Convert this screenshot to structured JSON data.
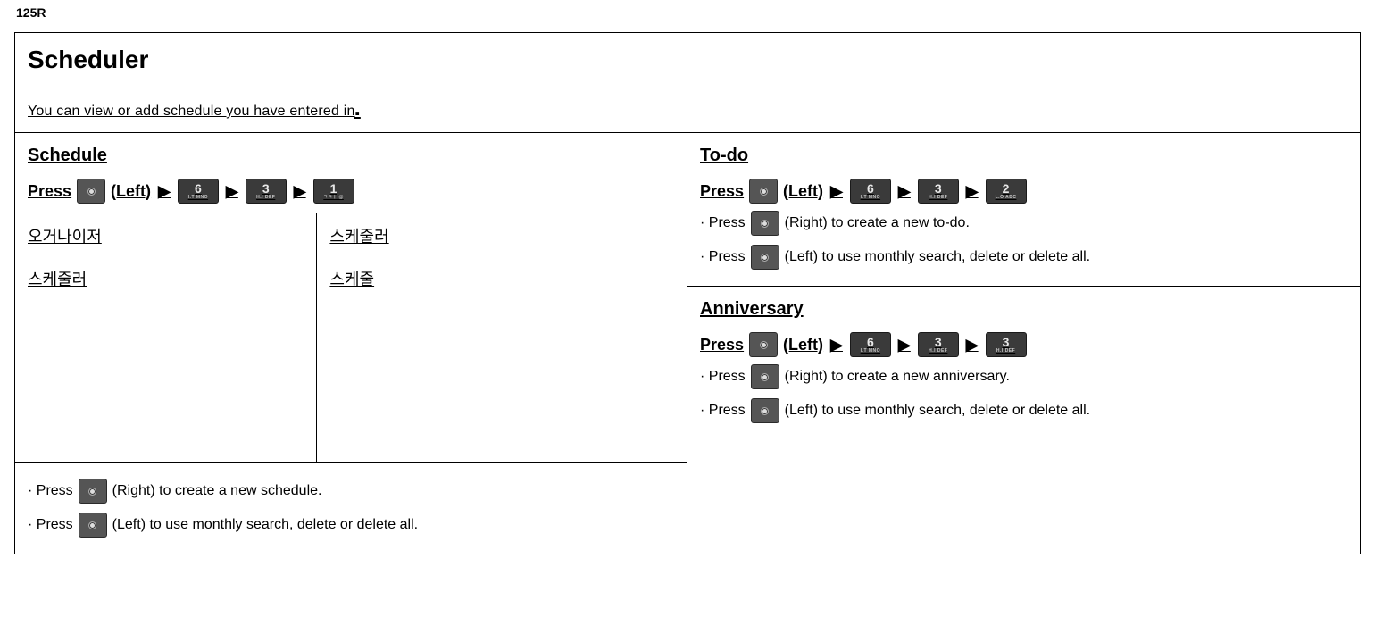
{
  "corner": "125R",
  "title": "Scheduler",
  "intro": "You can view or add schedule you have entered in",
  "schedule": {
    "heading": "Schedule",
    "press": "Press",
    "left_label": "(Left)",
    "keys": [
      "6",
      "3",
      "1"
    ],
    "sublabels": [
      "I.T MNO",
      "H.I DEF",
      "ㄱㅋㅣ @"
    ],
    "grid": {
      "c1r1": "오거나이저",
      "c1r2": "스케줄러",
      "c2r1": "스케줄러",
      "c2r2": "스케줄"
    },
    "b1": "(Right) to create a new schedule.",
    "b2": "(Left) to use monthly search, delete or delete all.",
    "bpress": "· Press"
  },
  "todo": {
    "heading": "To-do",
    "press": "Press",
    "left_label": "(Left)",
    "keys": [
      "6",
      "3",
      "2"
    ],
    "sublabels": [
      "I.T MNO",
      "H.I DEF",
      "L.O ABC"
    ],
    "b1": "(Right) to create a new to-do.",
    "b2": "(Left) to use monthly search, delete or delete all.",
    "bpress": "· Press"
  },
  "anniversary": {
    "heading": "Anniversary",
    "press": "Press",
    "left_label": "(Left)",
    "keys": [
      "6",
      "3",
      "3"
    ],
    "sublabels": [
      "I.T MNO",
      "H.I DEF",
      "H.I DEF"
    ],
    "b1": "(Right) to create a new anniversary.",
    "b2": "(Left) to use monthly search, delete or delete all.",
    "bpress": "· Press"
  }
}
